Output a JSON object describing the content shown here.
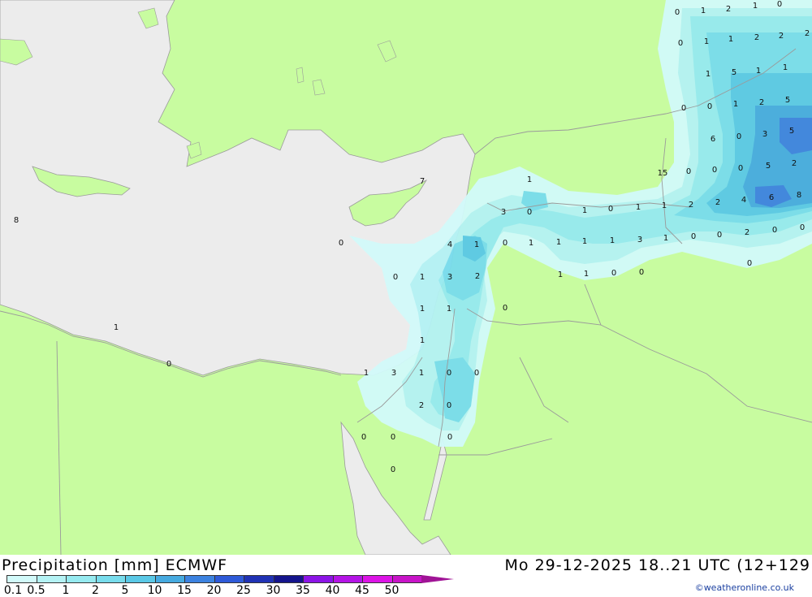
{
  "title": "Precipitation [mm] ECMWF",
  "valid_time": "Mo 29-12-2025 18..21 UTC (12+129",
  "credit": "©weatheronline.co.uk",
  "colors": {
    "land": "#c8fca0",
    "sea": "#ececec",
    "border": "#9a9a9a"
  },
  "legend": {
    "labels": [
      "0.1",
      "0.5",
      "1",
      "2",
      "5",
      "10",
      "15",
      "20",
      "25",
      "30",
      "35",
      "40",
      "45",
      "50"
    ],
    "colors": [
      "#d2fafa",
      "#b4f2f4",
      "#96eaf0",
      "#78dcec",
      "#5ac8e6",
      "#46aae0",
      "#3c82e0",
      "#2e5ad8",
      "#2032b4",
      "#14148c",
      "#8c14e6",
      "#b414e6",
      "#dc14e6",
      "#c814c8",
      "#a01496"
    ]
  },
  "map_values": [
    "0",
    "1",
    "2",
    "1",
    "0",
    "0",
    "1",
    "1",
    "2",
    "2",
    "2",
    "1",
    "5",
    "1",
    "1",
    "0",
    "0",
    "1",
    "2",
    "5",
    "6",
    "0",
    "3",
    "5",
    "15",
    "0",
    "0",
    "0",
    "5",
    "2",
    "7",
    "1",
    "2",
    "3",
    "0",
    "1",
    "0",
    "1",
    "1",
    "2",
    "4",
    "6",
    "8",
    "8",
    "0",
    "4",
    "1",
    "0",
    "1",
    "1",
    "1",
    "1",
    "3",
    "1",
    "0",
    "0",
    "2",
    "0",
    "0",
    "0",
    "1",
    "3",
    "2",
    "1",
    "1",
    "0",
    "0",
    "1",
    "1",
    "0",
    "1",
    "1",
    "0",
    "1",
    "3",
    "1",
    "0",
    "0",
    "2",
    "0",
    "0",
    "0",
    "0",
    "0",
    "0"
  ]
}
